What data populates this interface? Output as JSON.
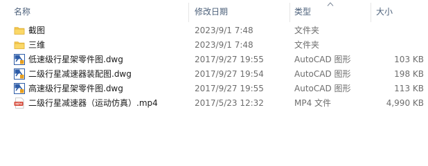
{
  "columns": {
    "name": "名称",
    "date": "修改日期",
    "type": "类型",
    "size": "大小"
  },
  "rows": [
    {
      "name": "截图",
      "date": "2023/9/1 7:48",
      "type": "文件夹",
      "size": "",
      "icon": "folder-icon"
    },
    {
      "name": "三维",
      "date": "2023/9/1 7:48",
      "type": "文件夹",
      "size": "",
      "icon": "folder-icon"
    },
    {
      "name": "低速级行星架零件图.dwg",
      "date": "2017/9/27 19:55",
      "type": "AutoCAD 图形",
      "size": "103 KB",
      "icon": "dwg-file-icon"
    },
    {
      "name": "二级行星减速器装配图.dwg",
      "date": "2017/9/27 19:54",
      "type": "AutoCAD 图形",
      "size": "198 KB",
      "icon": "dwg-file-icon"
    },
    {
      "name": "高速级行星架零件图.dwg",
      "date": "2017/9/27 19:55",
      "type": "AutoCAD 图形",
      "size": "113 KB",
      "icon": "dwg-file-icon"
    },
    {
      "name": "二级行星减速器（运动仿真）.mp4",
      "date": "2017/5/23 12:32",
      "type": "MP4 文件",
      "size": "4,990 KB",
      "icon": "mp4-file-icon"
    }
  ],
  "colors": {
    "header_text": "#4c607a",
    "folder": "#f6c84f",
    "dwg_blue": "#2e5da8",
    "mp4_red": "#d64a3a"
  }
}
